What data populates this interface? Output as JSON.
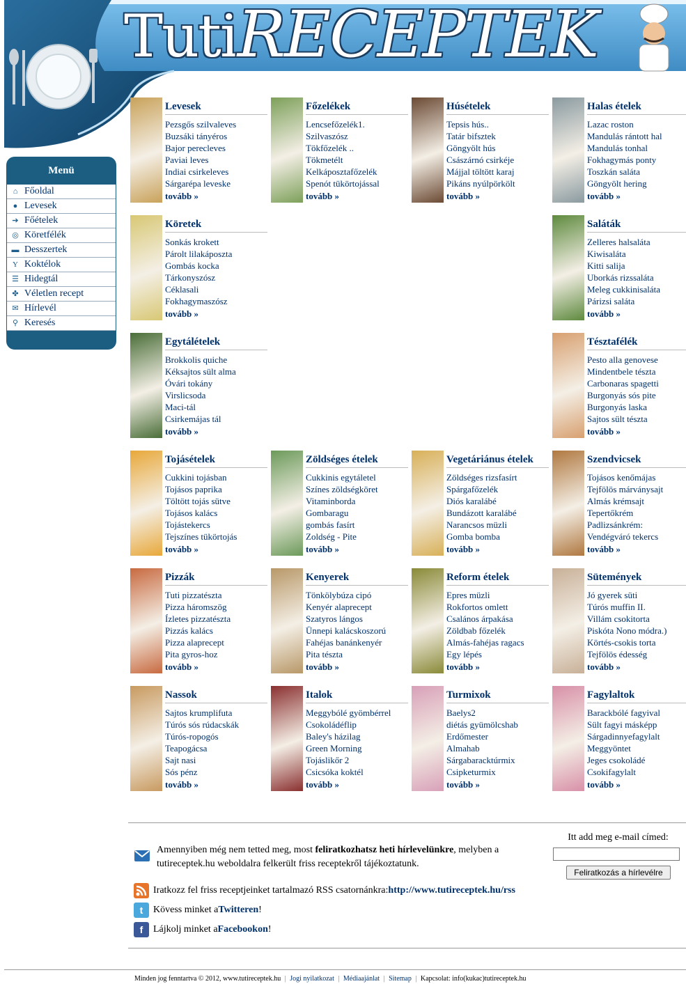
{
  "site": {
    "logo_small": "Tuti",
    "logo_big": "RECEPTEK"
  },
  "menu": {
    "title": "Menü",
    "items": [
      {
        "label": "Főoldal",
        "icon": "home-icon"
      },
      {
        "label": "Levesek",
        "icon": "soup-icon"
      },
      {
        "label": "Főételek",
        "icon": "main-dish-icon"
      },
      {
        "label": "Köretfélék",
        "icon": "side-dish-icon"
      },
      {
        "label": "Desszertek",
        "icon": "dessert-icon"
      },
      {
        "label": "Koktélok",
        "icon": "cocktail-icon"
      },
      {
        "label": "Hidegtál",
        "icon": "cold-plate-icon"
      },
      {
        "label": "Véletlen recept",
        "icon": "random-icon"
      },
      {
        "label": "Hírlevél",
        "icon": "mail-icon"
      },
      {
        "label": "Keresés",
        "icon": "search-icon"
      }
    ]
  },
  "categories": [
    {
      "title": "Levesek",
      "color": "#c9a25a",
      "items": [
        "Pezsgős szilvaleves",
        "Buzsáki tányéros",
        "Bajor perecleves",
        "Paviai leves",
        "Indiai csirkeleves",
        "Sárgarépa leveske"
      ],
      "more": "tovább »"
    },
    {
      "title": "Főzelékek",
      "color": "#7da05a",
      "items": [
        "Lencsefőzelék1.",
        "Szilvaszósz",
        "Tökfőzelék ..",
        "Tökmetélt",
        "Kelkáposztafőzelék",
        "Spenót tükörtojással"
      ],
      "more": "tovább »"
    },
    {
      "title": "Húsételek",
      "color": "#6b4a34",
      "items": [
        "Tepsis hús..",
        "Tatár bifsztek",
        "Göngyölt hús",
        "Császárnó csirkéje",
        "Májjal töltött karaj",
        "Pikáns nyúlpörkölt"
      ],
      "more": "tovább »"
    },
    {
      "title": "Halas ételek",
      "color": "#8a9aa0",
      "items": [
        "Lazac roston",
        "Mandulás rántott hal",
        "Mandulás tonhal",
        "Fokhagymás ponty",
        "Toszkán saláta",
        "Göngyölt hering"
      ],
      "more": "tovább »"
    },
    {
      "title": "Köretek",
      "color": "#d8c874",
      "items": [
        "Sonkás krokett",
        "Párolt lilakáposzta",
        "Gombás kocka",
        "Tárkonyszósz",
        "Céklasali",
        "Fokhagymaszósz"
      ],
      "more": "tovább »"
    },
    {
      "title": "Saláták",
      "color": "#5e8a3e",
      "items": [
        "Zelleres halsaláta",
        "Kiwisaláta",
        "Kitti salija",
        "Uborkás rizssaláta",
        "Meleg cukkinisaláta",
        "Párizsi saláta"
      ],
      "more": "tovább »"
    },
    {
      "title": "Egytálételek",
      "color": "#4a6e38",
      "items": [
        "Brokkolis quiche",
        "Kéksajtos sült alma",
        "Óvári tokány",
        "Virslicsoda",
        "Maci-tál",
        "Csirkemájas tál"
      ],
      "more": "tovább »"
    },
    {
      "title": "Tésztafélék",
      "color": "#d8a070",
      "items": [
        "Pesto alla genovese",
        "Mindentbele tészta",
        "Carbonaras spagetti",
        "Burgonyás sós pite",
        "Burgonyás laska",
        "Sajtos sült tészta"
      ],
      "more": "tovább »"
    },
    {
      "title": "Tojásételek",
      "color": "#e8a83a",
      "items": [
        "Cukkini tojásban",
        "Tojásos paprika",
        "Töltött tojás sütve",
        "Tojásos kalács",
        "Tojástekercs",
        "Tejszínes tükörtojás"
      ],
      "more": "tovább »"
    },
    {
      "title": "Zöldséges ételek",
      "color": "#6c9a5a",
      "items": [
        "Cukkinis egytáletel",
        "Színes zöldségköret",
        "Vitaminborda",
        "Gombaragu",
        "gombás fasírt",
        "Zoldség - Pite"
      ],
      "more": "tovább »"
    },
    {
      "title": "Vegetáriánus ételek",
      "color": "#d8b058",
      "items": [
        "Zöldséges rizsfasírt",
        "Spárgafőzelék",
        "Diós karalábé",
        "Bundázott karalábé",
        "Narancsos müzli",
        "Gomba bomba"
      ],
      "more": "tovább »"
    },
    {
      "title": "Szendvicsek",
      "color": "#b07840",
      "items": [
        "Tojásos kenőmájas",
        "Tejfölös márványsajt",
        "Almás krémsajt",
        "Tepertőkrém",
        "Padlizsánkrém:",
        "Vendégváró tekercs"
      ],
      "more": "tovább »"
    },
    {
      "title": "Pizzák",
      "color": "#c86a40",
      "items": [
        "Tuti pizzatészta",
        "Pizza háromszög",
        "Ízletes pizzatészta",
        "Pizzás kalács",
        "Pizza alaprecept",
        "Pita gyros-hoz"
      ],
      "more": "tovább »"
    },
    {
      "title": "Kenyerek",
      "color": "#b89868",
      "items": [
        "Tönkölybúza cipó",
        "Kenyér alaprecept",
        "Szatyros lángos",
        "Ünnepi kalácskoszorú",
        "Fahéjas banánkenyér",
        "Pita tészta"
      ],
      "more": "tovább »"
    },
    {
      "title": "Reform ételek",
      "color": "#8a8a38",
      "items": [
        "Epres müzli",
        "Rokfortos omlett",
        "Csalános árpakása",
        "Zöldbab főzelék",
        "Almás-fahéjas ragacs",
        "Egy lépés"
      ],
      "more": "tovább »"
    },
    {
      "title": "Sütemények",
      "color": "#c8b098",
      "items": [
        "Jó gyerek süti",
        "Túrós muffin II.",
        "Villám csokitorta",
        "Piskóta Nono módra.)",
        "Körtés-csokis torta",
        "Tejfölös édesség"
      ],
      "more": "tovább »"
    },
    {
      "title": "Nassok",
      "color": "#c89a60",
      "items": [
        "Sajtos krumplifuta",
        "Túrós sós rúdacskák",
        "Túrós-ropogós",
        "Teapogácsa",
        "Sajt nasi",
        "Sós pénz"
      ],
      "more": "tovább »"
    },
    {
      "title": "Italok",
      "color": "#8a3030",
      "items": [
        "Meggybólé gyömbérrel",
        "Csokoládéflip",
        "Baley's házilag",
        "Green Morning",
        "Tojáslikőr 2",
        "Csicsóka koktél"
      ],
      "more": "tovább »"
    },
    {
      "title": "Turmixok",
      "color": "#d8a0b8",
      "items": [
        "Baelys2",
        "diétás gyümölcshab",
        "Erdőmester",
        "Almahab",
        "Sárgabaracktúrmix",
        "Csipketurmix"
      ],
      "more": "tovább »"
    },
    {
      "title": "Fagylaltok",
      "color": "#d890a8",
      "items": [
        "Barackbólé fagyival",
        "Sült fagyi másképp",
        "Sárgadinnyefagylalt",
        "Meggyöntet",
        "Jeges csokoládé",
        "Csokifagylalt"
      ],
      "more": "tovább »"
    }
  ],
  "newsletter": {
    "text_before": "Amennyiben még nem tetted meg, most ",
    "text_bold": "feliratkozhatsz heti hírlevelünkre",
    "text_after": ", melyben a tutireceptek.hu weboldalra felkerült friss receptekről tájékoztatunk.",
    "email_label": "Itt add meg e-mail címed:",
    "email_value": "",
    "button": "Feliratkozás a hírlevélre"
  },
  "social": {
    "rss_text": "Iratkozz fel friss receptjeinket tartalmazó RSS csatornánkra: ",
    "rss_link": "http://www.tutireceptek.hu/rss",
    "twitter_text": "Kövess minket a ",
    "twitter_link": "Twitteren",
    "twitter_end": "!",
    "facebook_text": "Lájkolj minket a ",
    "facebook_link": "Facebookon",
    "facebook_end": "!"
  },
  "footer": {
    "copyright": "Minden jog fenntartva © 2012, www.tutireceptek.hu",
    "links": [
      "Jogi nyilatkozat",
      "Médiaajánlat",
      "Sitemap"
    ],
    "contact": "Kapcsolat: info(kukac)tutireceptek.hu",
    "separator": "|"
  },
  "colors": {
    "header_blue": "#5aa6d8",
    "menu_blue": "#1b5e82",
    "link_blue": "#00306a"
  }
}
